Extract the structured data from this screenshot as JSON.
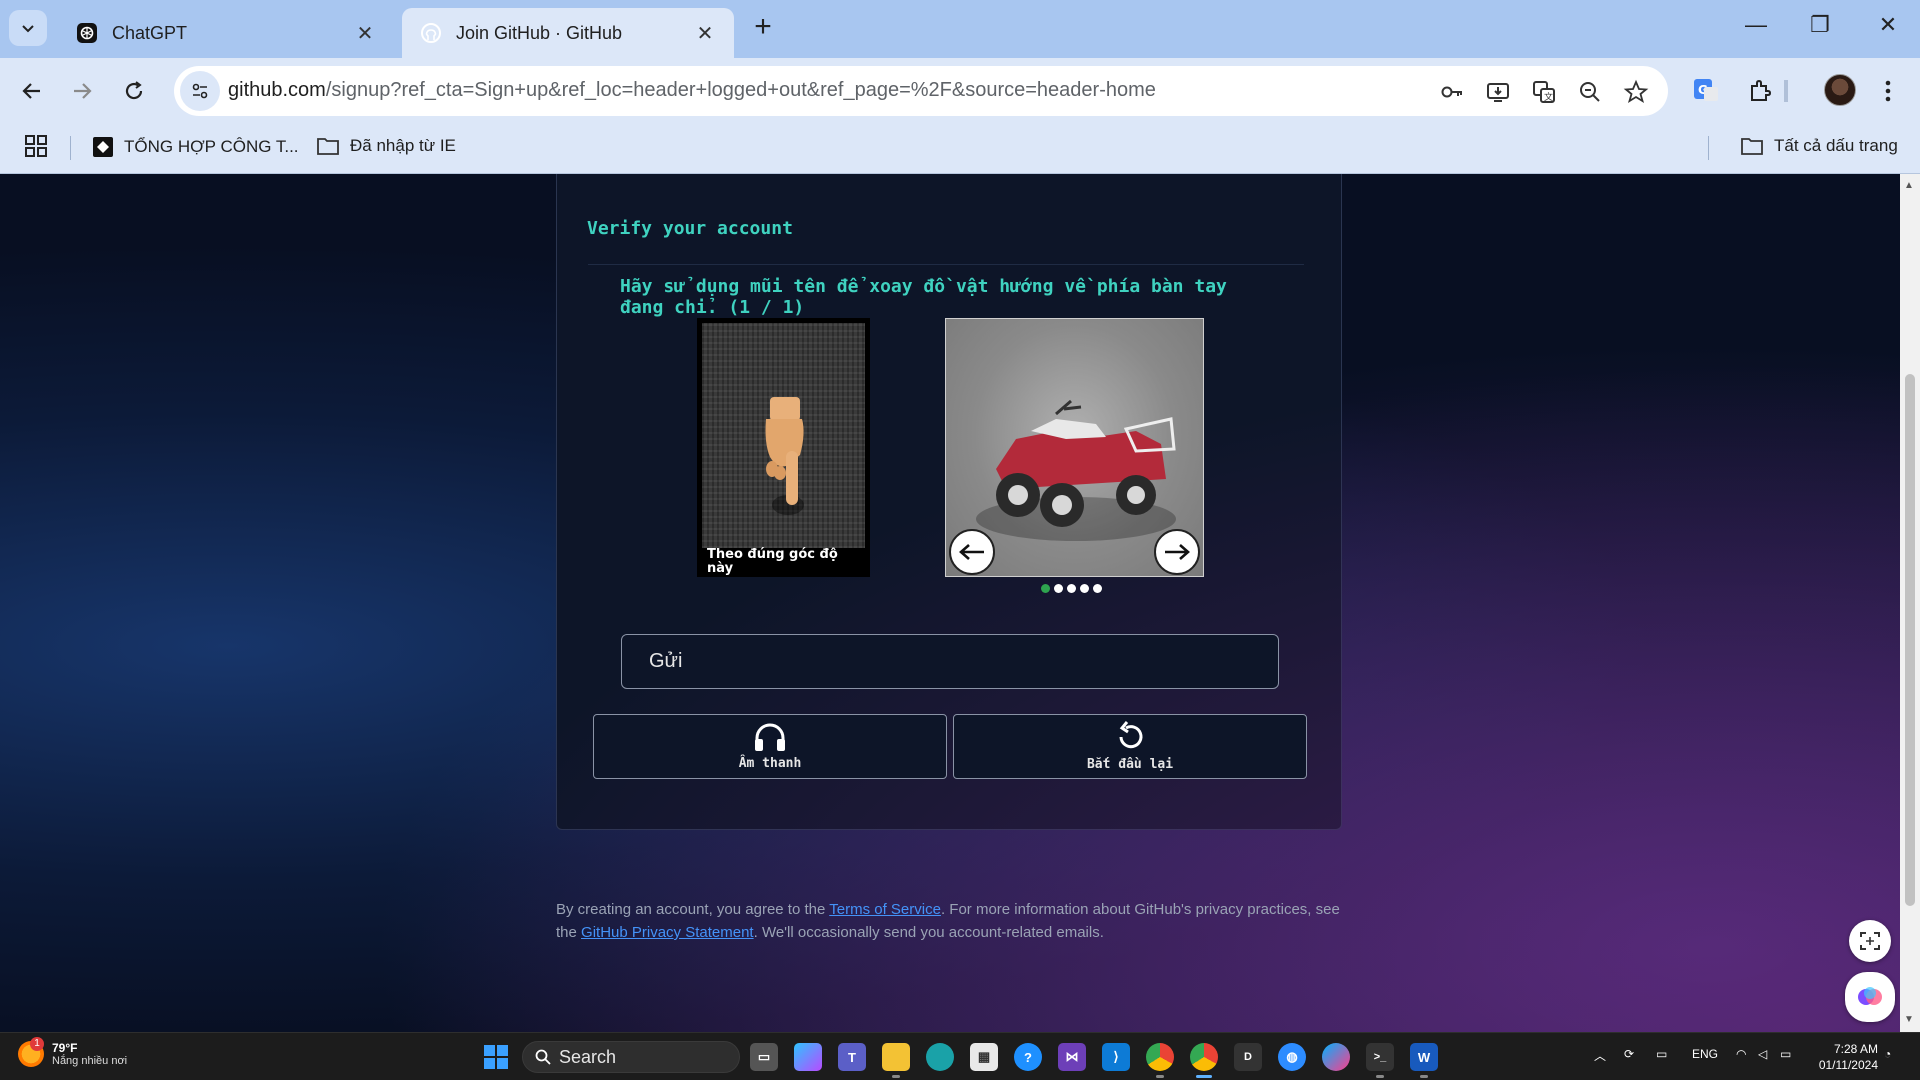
{
  "browser": {
    "tabs": [
      {
        "title": "ChatGPT",
        "icon": "chatgpt-icon",
        "active": false
      },
      {
        "title": "Join GitHub · GitHub",
        "icon": "github-icon",
        "active": true
      }
    ],
    "url_host": "github.com",
    "url_path": "/signup?ref_cta=Sign+up&ref_loc=header+logged+out&ref_page=%2F&source=header-home",
    "bookmarks": [
      {
        "label": "TỔNG HỢP CÔNG T...",
        "icon": "site-icon"
      },
      {
        "label": "Đã nhập từ IE",
        "icon": "folder-icon"
      }
    ],
    "all_bookmarks": "Tất cả dấu trang"
  },
  "page": {
    "step_title": "Verify your account",
    "captcha": {
      "instruction_part1": "Hãy sử dụng mũi tên để xoay đồ vật hướng về phía bàn tay đang chỉ.",
      "progress": "(1 / 1)",
      "reference_caption": "Theo đúng góc độ này",
      "dots_total": 5,
      "dot_active_index": 0
    },
    "submit_label": "Gửi",
    "audio_label": "Âm thanh",
    "restart_label": "Bắt đầu lại",
    "legal": {
      "text1": "By creating an account, you agree to the ",
      "terms_link": "Terms of Service",
      "text2": ". For more information about GitHub's privacy practices, see the ",
      "privacy_link": "GitHub Privacy Statement",
      "text3": ". We'll occasionally send you account-related emails."
    }
  },
  "taskbar": {
    "weather_temp": "79°F",
    "weather_desc": "Nắng nhiều nơi",
    "weather_badge": "1",
    "search_label": "Search",
    "language": "ENG",
    "time": "7:28 AM",
    "date": "01/11/2024"
  },
  "colors": {
    "accent_teal": "#3fd2c0",
    "link_blue": "#4493f8",
    "dot_active": "#2ea44f"
  }
}
